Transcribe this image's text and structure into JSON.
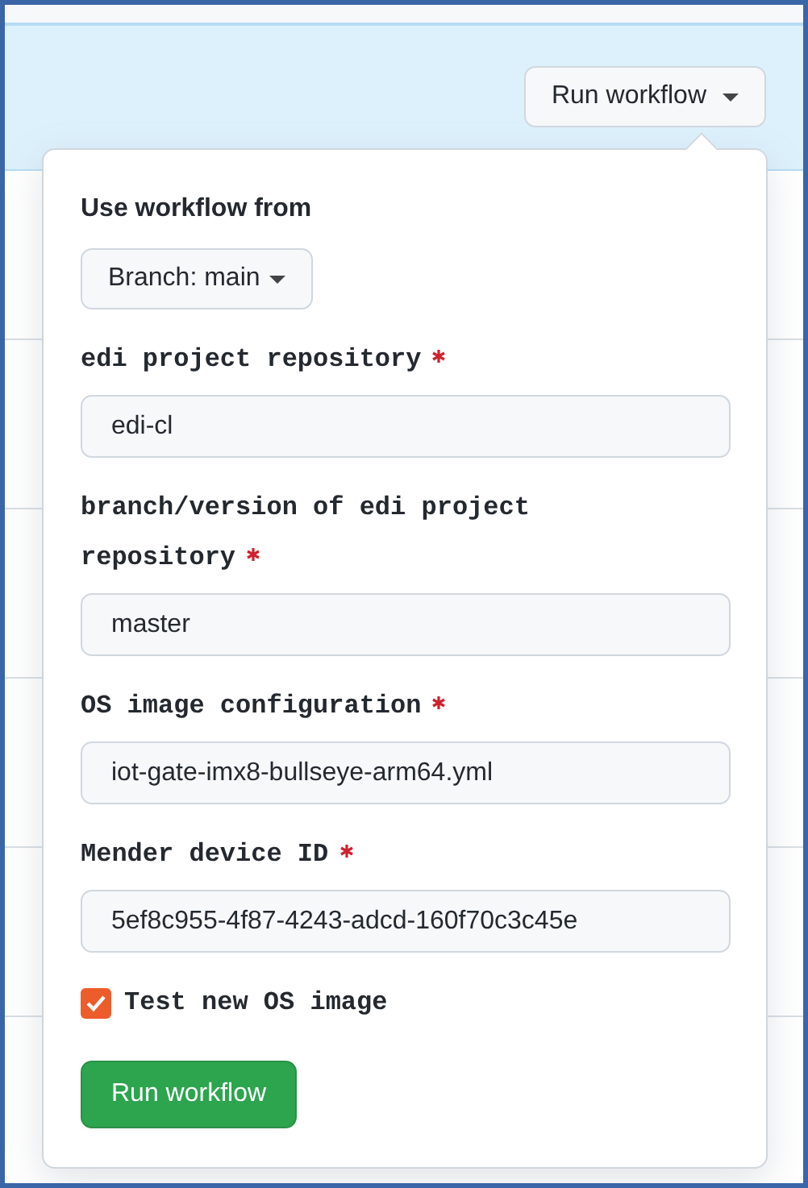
{
  "header_button": {
    "label": "Run workflow"
  },
  "popup": {
    "branch_label": "Use workflow from",
    "branch_button": "Branch: main",
    "fields": [
      {
        "label": "edi project repository",
        "required": true,
        "value": "edi-cl"
      },
      {
        "label": "branch/version of edi project repository",
        "required": true,
        "value": "master"
      },
      {
        "label": "OS image configuration",
        "required": true,
        "value": "iot-gate-imx8-bullseye-arm64.yml"
      },
      {
        "label": "Mender device ID",
        "required": true,
        "value": "5ef8c955-4f87-4243-adcd-160f70c3c45e"
      }
    ],
    "checkbox": {
      "label": "Test new OS image",
      "checked": true
    },
    "submit": "Run workflow"
  }
}
